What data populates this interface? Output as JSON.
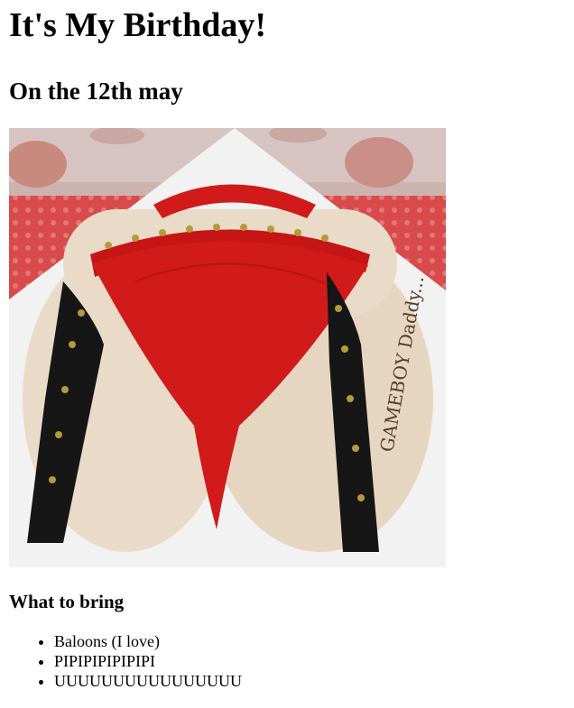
{
  "heading": "It's My Birthday!",
  "subheading": "On the 12th may",
  "image": {
    "alt": "Novelty cake in the shape of a bottom wearing a red studded thong with black straps",
    "writing": "GAMEBOY Daddy..."
  },
  "bring": {
    "title": "What to bring",
    "items": [
      "Baloons (I love)",
      "PIPIPIPIPIPIPI",
      "UUUUUUUUUUUUUUUU"
    ]
  },
  "colors": {
    "thong_red": "#d11a1a",
    "skin": "#e9dbc8",
    "strap_black": "#161616",
    "stud_gold": "#b59a3c",
    "board": "#f2f2f2",
    "tablecloth": "#d94a4a"
  }
}
